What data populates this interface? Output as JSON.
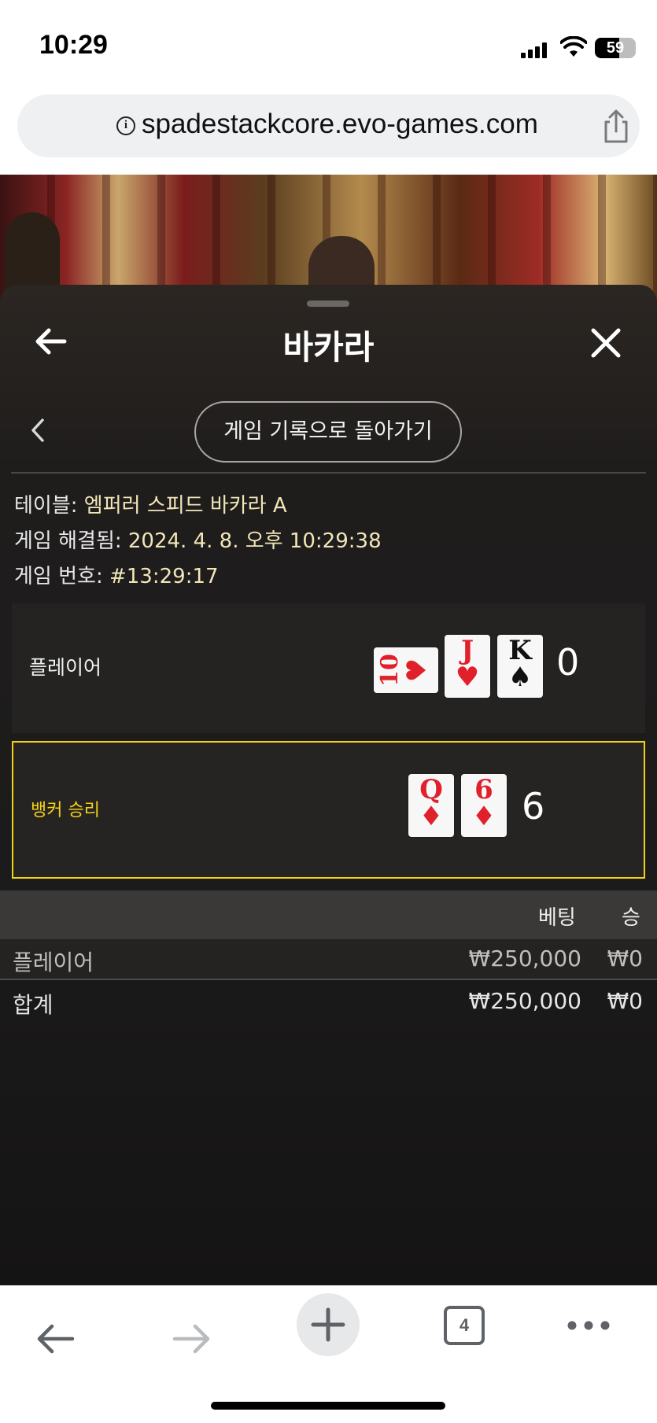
{
  "status_bar": {
    "time": "10:29",
    "battery_level": "59"
  },
  "browser": {
    "url": "spadestackcore.evo-games.com",
    "tab_count": "4"
  },
  "panel": {
    "title": "바카라",
    "back_to_history_label": "게임 기록으로 돌아가기"
  },
  "game_info": {
    "table_label": "테이블: ",
    "table_value": "엠퍼러 스피드 바카라 A",
    "resolved_label": "게임 해결됨: ",
    "resolved_value": "2024. 4. 8. 오후 10:29:38",
    "number_label": "게임 번호: ",
    "number_value": "#13:29:17"
  },
  "hands": {
    "player": {
      "label": "플레이어",
      "score": "0",
      "cards": [
        {
          "rank": "10",
          "suit": "♥",
          "color": "red",
          "sideways": true
        },
        {
          "rank": "J",
          "suit": "♥",
          "color": "red",
          "sideways": false
        },
        {
          "rank": "K",
          "suit": "♠",
          "color": "black",
          "sideways": false
        }
      ]
    },
    "banker": {
      "label": "뱅커 승리",
      "score": "6",
      "cards": [
        {
          "rank": "Q",
          "suit": "♦",
          "color": "red",
          "sideways": false
        },
        {
          "rank": "6",
          "suit": "♦",
          "color": "red",
          "sideways": false
        }
      ]
    }
  },
  "bets": {
    "header_bet": "베팅",
    "header_win": "승",
    "rows": [
      {
        "name": "플레이어",
        "bet": "₩250,000",
        "win": "₩0"
      },
      {
        "name": "합계",
        "bet": "₩250,000",
        "win": "₩0"
      }
    ]
  },
  "colors": {
    "winner_highlight": "#f2d214",
    "card_red": "#e0202a"
  },
  "icons": {
    "back": "arrow-left-icon",
    "close": "close-icon",
    "chevron": "chevron-left-icon",
    "share": "share-icon",
    "info": "info-icon",
    "new_tab": "plus-icon",
    "more": "more-icon"
  }
}
